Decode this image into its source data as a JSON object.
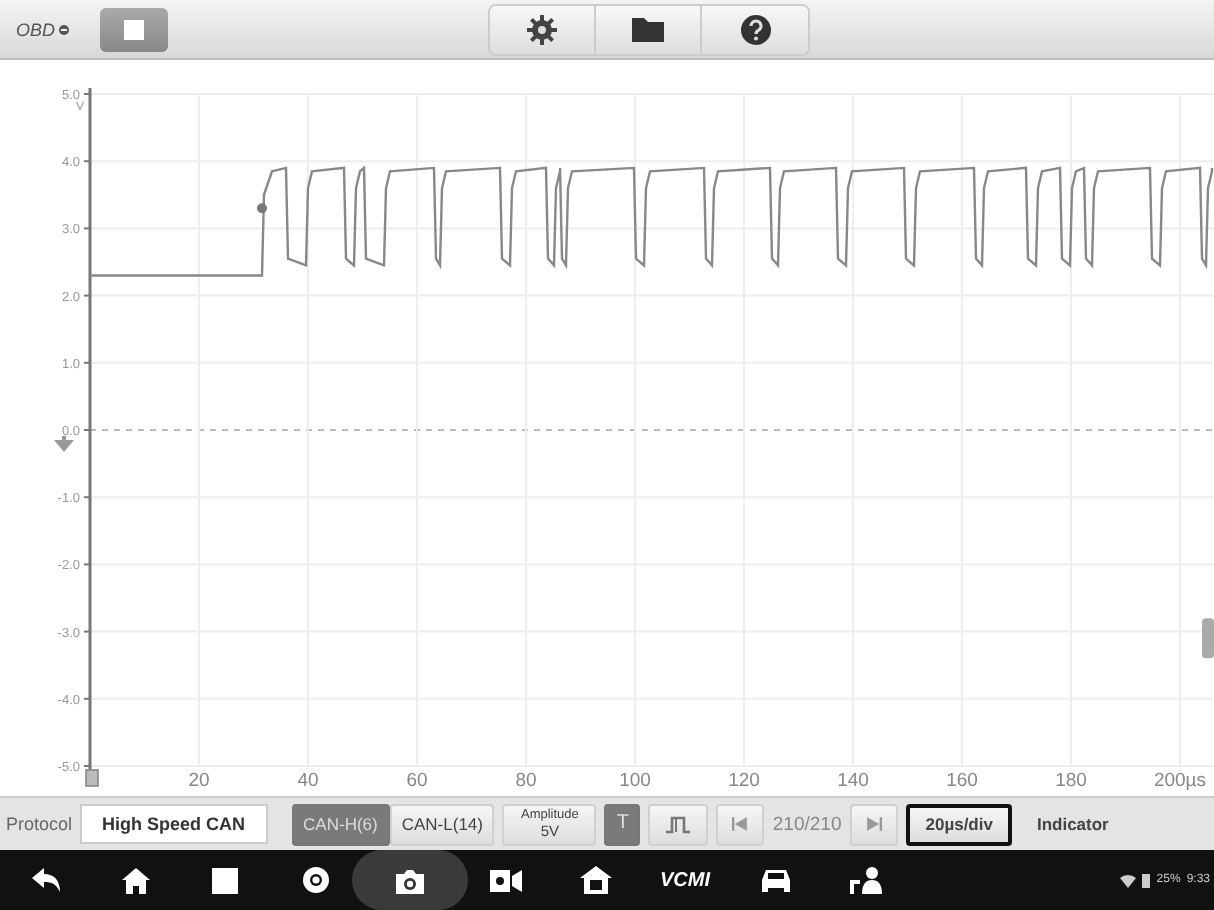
{
  "toolbar": {
    "logo": "OBD",
    "left_buttons": [
      {
        "kind": "stop"
      }
    ],
    "center_buttons": [
      {
        "kind": "settings"
      },
      {
        "kind": "folder"
      },
      {
        "kind": "help"
      }
    ]
  },
  "plot": {
    "unit": "V",
    "y_ticks": [
      "5.0",
      "4.0",
      "3.0",
      "2.0",
      "1.0",
      "0.0",
      "-1.0",
      "-2.0",
      "-3.0",
      "-4.0",
      "-5.0"
    ],
    "x_ticks": [
      "20",
      "40",
      "60",
      "80",
      "100",
      "120",
      "140",
      "160",
      "180",
      "200µs"
    ]
  },
  "controls": [
    {
      "kind": "label",
      "text": "Protocol"
    },
    {
      "kind": "field",
      "value": "High Speed CAN"
    },
    {
      "kind": "segmented",
      "options": [
        {
          "label": "CAN-H(6)",
          "selected": true
        },
        {
          "label": "CAN-L(14)",
          "selected": false
        }
      ]
    },
    {
      "kind": "button",
      "label": "Amplitude",
      "value": "5V",
      "focused": false
    },
    {
      "kind": "toggle",
      "label": "T",
      "selected": true
    },
    {
      "kind": "pulse"
    },
    {
      "kind": "first"
    },
    {
      "kind": "counter",
      "text": "210/210"
    },
    {
      "kind": "last"
    },
    {
      "kind": "button",
      "label": "20µs/div",
      "focused": true
    },
    {
      "kind": "button",
      "label": "Indicator",
      "focused": false
    }
  ],
  "nav_bar": {
    "items": [
      {
        "kind": "back",
        "selected": false
      },
      {
        "kind": "home",
        "selected": false
      },
      {
        "kind": "recent",
        "selected": false
      },
      {
        "kind": "browser",
        "selected": false
      },
      {
        "kind": "camera",
        "selected": true
      },
      {
        "kind": "record",
        "selected": false
      },
      {
        "kind": "shop",
        "selected": false
      },
      {
        "kind": "vcmi",
        "text": "VCMI",
        "selected": false
      },
      {
        "kind": "car",
        "selected": false
      },
      {
        "kind": "users",
        "selected": false
      }
    ],
    "status": {
      "battery": "25%",
      "time": "9:33"
    }
  }
}
